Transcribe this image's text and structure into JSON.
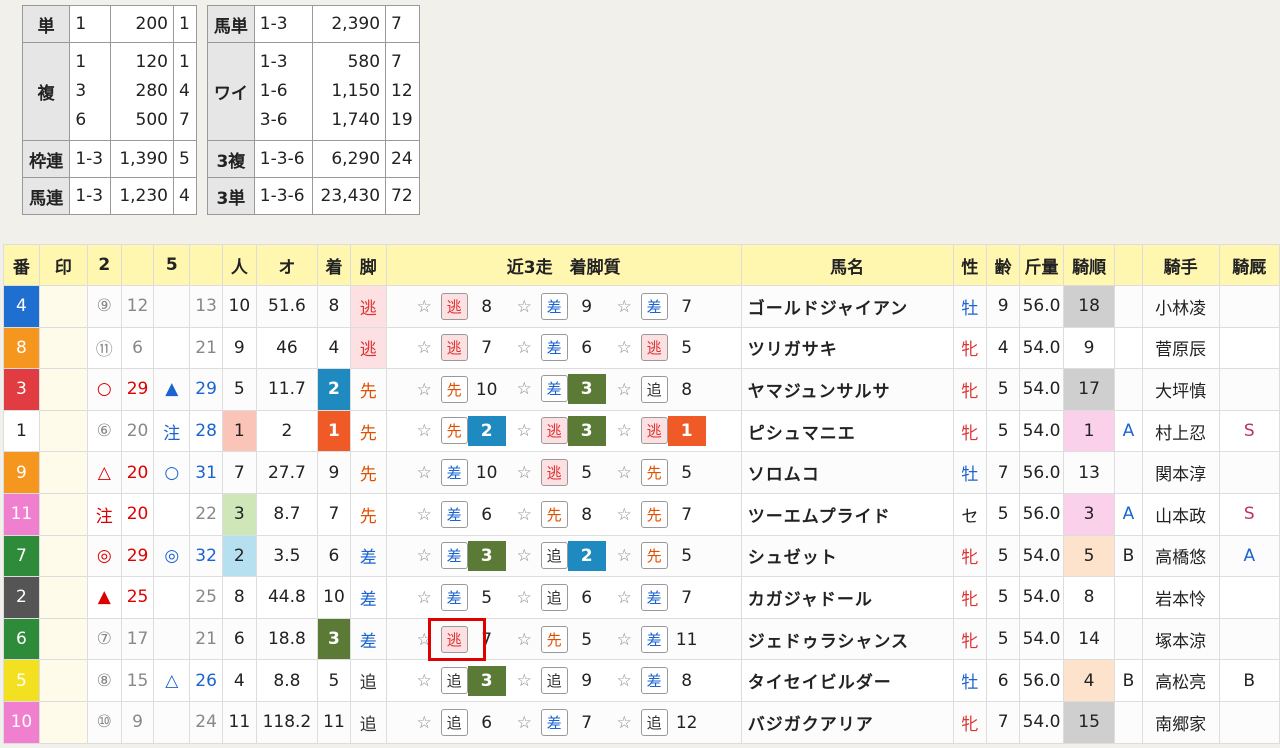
{
  "payouts_left": {
    "tan": {
      "label": "単",
      "horse": "1",
      "amount": "200",
      "pop": "1"
    },
    "fuku": {
      "label": "複",
      "horses": [
        "1",
        "3",
        "6"
      ],
      "amounts": [
        "120",
        "280",
        "500"
      ],
      "pops": [
        "1",
        "4",
        "7"
      ]
    },
    "wakuren": {
      "label": "枠連",
      "combo": "1-3",
      "amount": "1,390",
      "pop": "5"
    },
    "umaren": {
      "label": "馬連",
      "combo": "1-3",
      "amount": "1,230",
      "pop": "4"
    }
  },
  "payouts_right": {
    "umatan": {
      "label": "馬単",
      "combo": "1-3",
      "amount": "2,390",
      "pop": "7"
    },
    "wide": {
      "label": "ワイ",
      "combos": [
        "1-3",
        "1-6",
        "3-6"
      ],
      "amounts": [
        "580",
        "1,150",
        "1,740"
      ],
      "pops": [
        "7",
        "12",
        "19"
      ]
    },
    "sanrenpuku": {
      "label": "3複",
      "combo": "1-3-6",
      "amount": "6,290",
      "pop": "24"
    },
    "sanrentan": {
      "label": "3単",
      "combo": "1-3-6",
      "amount": "23,430",
      "pop": "72"
    }
  },
  "table": {
    "headers": {
      "ban": "番",
      "shirushi": "印",
      "h2": "2",
      "h2b": "",
      "h5": "5",
      "h5b": "",
      "ninki": "人",
      "odds": "オ",
      "chaku": "着",
      "kyaku": "脚",
      "recent": "近3走　着脚質",
      "name": "馬名",
      "sex": "性",
      "age": "齢",
      "kinryo": "斤量",
      "kijun": "騎順",
      "blank": "",
      "jockey": "騎手",
      "kikyu": "騎厩"
    },
    "rows": [
      {
        "ban": "4",
        "color": "#1f6fd0",
        "m2": "⑨",
        "v2": "12",
        "m5": "",
        "v5": "13",
        "ninki": "10",
        "odds": "51.6",
        "chaku": "8",
        "kyaku": "逃",
        "recent": [
          {
            "leg": "逃",
            "fin": "8"
          },
          {
            "leg": "差",
            "fin": "9"
          },
          {
            "leg": "差",
            "fin": "7"
          }
        ],
        "name": "ゴールドジャイアン",
        "sex": "牡",
        "age": "9",
        "kinryo": "56.0",
        "kijun": "18",
        "kijun_bg": "#cfcfcf",
        "mk": "",
        "jockey": "小林凌",
        "kikyu": ""
      },
      {
        "ban": "8",
        "color": "#f5961e",
        "m2": "⑪",
        "v2": "6",
        "m5": "",
        "v5": "21",
        "ninki": "9",
        "odds": "46",
        "chaku": "4",
        "kyaku": "逃",
        "recent": [
          {
            "leg": "逃",
            "fin": "7"
          },
          {
            "leg": "差",
            "fin": "6"
          },
          {
            "leg": "逃",
            "fin": "5"
          }
        ],
        "name": "ツリガサキ",
        "sex": "牝",
        "age": "4",
        "kinryo": "54.0",
        "kijun": "9",
        "kijun_bg": "",
        "mk": "",
        "jockey": "菅原辰",
        "kikyu": ""
      },
      {
        "ban": "3",
        "color": "#e03c41",
        "m2": "○",
        "v2": "29",
        "m5": "▲",
        "v5": "29",
        "ninki": "5",
        "odds": "11.7",
        "chaku": "2",
        "kyaku": "先",
        "recent": [
          {
            "leg": "先",
            "fin": "10"
          },
          {
            "leg": "差",
            "fin": "3"
          },
          {
            "leg": "追",
            "fin": "8"
          }
        ],
        "name": "ヤマジュンサルサ",
        "sex": "牝",
        "age": "5",
        "kinryo": "54.0",
        "kijun": "17",
        "kijun_bg": "#cfcfcf",
        "mk": "",
        "jockey": "大坪慎",
        "kikyu": ""
      },
      {
        "ban": "1",
        "color": "#ffffff",
        "m2": "⑥",
        "v2": "20",
        "m5": "注",
        "v5": "28",
        "ninki": "1",
        "odds": "2",
        "chaku": "1",
        "kyaku": "先",
        "recent": [
          {
            "leg": "先",
            "fin": "2"
          },
          {
            "leg": "逃",
            "fin": "3"
          },
          {
            "leg": "逃",
            "fin": "1"
          }
        ],
        "name": "ピシュマニエ",
        "sex": "牝",
        "age": "5",
        "kinryo": "54.0",
        "kijun": "1",
        "kijun_bg": "#fbd0ea",
        "mk": "A",
        "jockey": "村上忍",
        "kikyu": "S"
      },
      {
        "ban": "9",
        "color": "#f5961e",
        "m2": "△",
        "v2": "20",
        "m5": "○",
        "v5": "31",
        "ninki": "7",
        "odds": "27.7",
        "chaku": "9",
        "kyaku": "先",
        "recent": [
          {
            "leg": "差",
            "fin": "10"
          },
          {
            "leg": "逃",
            "fin": "5"
          },
          {
            "leg": "先",
            "fin": "5"
          }
        ],
        "name": "ソロムコ",
        "sex": "牡",
        "age": "7",
        "kinryo": "56.0",
        "kijun": "13",
        "kijun_bg": "",
        "mk": "",
        "jockey": "関本淳",
        "kikyu": ""
      },
      {
        "ban": "11",
        "color": "#f07fd0",
        "m2": "注",
        "v2": "20",
        "m5": "",
        "v5": "22",
        "ninki": "3",
        "odds": "8.7",
        "chaku": "7",
        "kyaku": "先",
        "recent": [
          {
            "leg": "差",
            "fin": "6"
          },
          {
            "leg": "先",
            "fin": "8"
          },
          {
            "leg": "先",
            "fin": "7"
          }
        ],
        "name": "ツーエムプライド",
        "sex": "セ",
        "age": "5",
        "kinryo": "56.0",
        "kijun": "3",
        "kijun_bg": "#fbd0ea",
        "mk": "A",
        "jockey": "山本政",
        "kikyu": "S"
      },
      {
        "ban": "7",
        "color": "#2e8b3a",
        "m2": "◎",
        "v2": "29",
        "m5": "◎",
        "v5": "32",
        "ninki": "2",
        "odds": "3.5",
        "chaku": "6",
        "kyaku": "差",
        "recent": [
          {
            "leg": "差",
            "fin": "3"
          },
          {
            "leg": "追",
            "fin": "2"
          },
          {
            "leg": "先",
            "fin": "5"
          }
        ],
        "name": "シュゼット",
        "sex": "牝",
        "age": "5",
        "kinryo": "54.0",
        "kijun": "5",
        "kijun_bg": "#fde3cc",
        "mk": "B",
        "jockey": "高橋悠",
        "kikyu": "A"
      },
      {
        "ban": "2",
        "color": "#555555",
        "m2": "▲",
        "v2": "25",
        "m5": "",
        "v5": "25",
        "ninki": "8",
        "odds": "44.8",
        "chaku": "10",
        "kyaku": "差",
        "recent": [
          {
            "leg": "差",
            "fin": "5"
          },
          {
            "leg": "追",
            "fin": "6"
          },
          {
            "leg": "差",
            "fin": "7"
          }
        ],
        "name": "カガジャドール",
        "sex": "牝",
        "age": "5",
        "kinryo": "54.0",
        "kijun": "8",
        "kijun_bg": "",
        "mk": "",
        "jockey": "岩本怜",
        "kikyu": ""
      },
      {
        "ban": "6",
        "color": "#2e8b3a",
        "m2": "⑦",
        "v2": "17",
        "m5": "",
        "v5": "21",
        "ninki": "6",
        "odds": "18.8",
        "chaku": "3",
        "kyaku": "差",
        "recent": [
          {
            "leg": "逃",
            "fin": "7"
          },
          {
            "leg": "先",
            "fin": "5"
          },
          {
            "leg": "差",
            "fin": "11"
          }
        ],
        "name": "ジェドゥラシャンス",
        "sex": "牝",
        "age": "5",
        "kinryo": "54.0",
        "kijun": "14",
        "kijun_bg": "",
        "mk": "",
        "jockey": "塚本涼",
        "kikyu": ""
      },
      {
        "ban": "5",
        "color": "#f3e021",
        "m2": "⑧",
        "v2": "15",
        "m5": "△",
        "v5": "26",
        "ninki": "4",
        "odds": "8.8",
        "chaku": "5",
        "kyaku": "追",
        "recent": [
          {
            "leg": "追",
            "fin": "3"
          },
          {
            "leg": "追",
            "fin": "9"
          },
          {
            "leg": "差",
            "fin": "8"
          }
        ],
        "name": "タイセイビルダー",
        "sex": "牡",
        "age": "6",
        "kinryo": "56.0",
        "kijun": "4",
        "kijun_bg": "#fde3cc",
        "mk": "B",
        "jockey": "高松亮",
        "kikyu": "B"
      },
      {
        "ban": "10",
        "color": "#f07fd0",
        "m2": "⑩",
        "v2": "9",
        "m5": "",
        "v5": "24",
        "ninki": "11",
        "odds": "118.2",
        "chaku": "11",
        "kyaku": "追",
        "recent": [
          {
            "leg": "追",
            "fin": "6"
          },
          {
            "leg": "差",
            "fin": "7"
          },
          {
            "leg": "追",
            "fin": "12"
          }
        ],
        "name": "バジガクアリア",
        "sex": "牝",
        "age": "7",
        "kinryo": "54.0",
        "kijun": "15",
        "kijun_bg": "#cfcfcf",
        "mk": "",
        "jockey": "南郷家",
        "kikyu": ""
      }
    ]
  },
  "colors": {
    "gold": "#f5c400",
    "win": "#ef5a26",
    "place": "#1e8ac0",
    "show": "#5a7a36",
    "highlight": "#e10000"
  }
}
